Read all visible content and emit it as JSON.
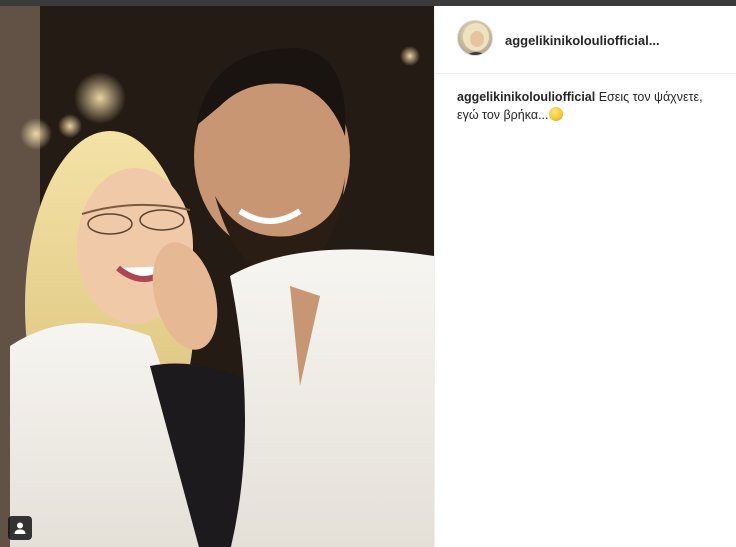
{
  "post": {
    "username": "aggelikinikolouliofficial",
    "username_truncated": "aggelikinikolouliofficial...",
    "caption": "Εσεις τον ψάχνετε, εγώ τον βρήκα...",
    "caption_emoji": "laughing-face-emoji"
  },
  "icons": {
    "user_tag": "user-tag-icon",
    "avatar": "profile-avatar"
  },
  "colors": {
    "text": "#262626",
    "border": "#efefef",
    "background": "#ffffff"
  }
}
